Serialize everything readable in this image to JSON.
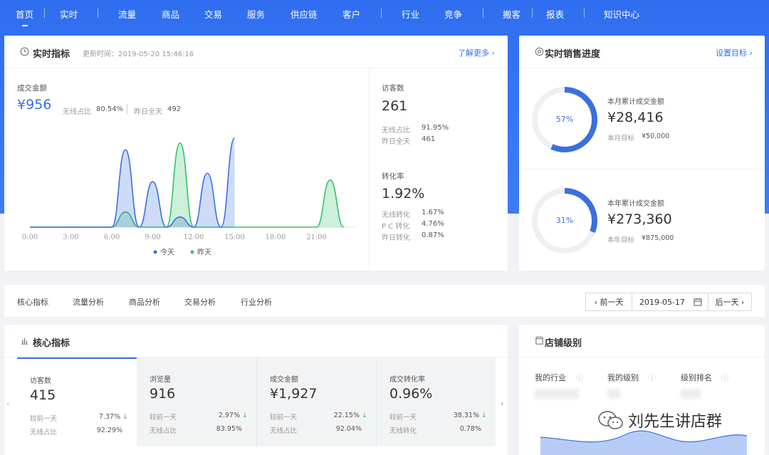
{
  "nav": {
    "items": [
      {
        "label": "首页",
        "active": true
      },
      {
        "label": "实时"
      },
      {
        "label": "流量"
      },
      {
        "label": "商品"
      },
      {
        "label": "交易"
      },
      {
        "label": "服务"
      },
      {
        "label": "供应链"
      },
      {
        "label": "客户"
      },
      {
        "label": "行业"
      },
      {
        "label": "竞争"
      },
      {
        "label": "搬客"
      },
      {
        "label": "报表"
      },
      {
        "label": "知识中心"
      }
    ]
  },
  "realtime": {
    "title": "实时指标",
    "updated_label": "更新时间：2019-05-20 15:46:16",
    "more_link": "了解更多 ›",
    "deal": {
      "label": "成交金额",
      "value": "¥956",
      "wireless_label": "无线占比",
      "wireless_value": "80.54%",
      "yesterday_label": "昨日全天",
      "yesterday_value": "492"
    },
    "visitors": {
      "label": "访客数",
      "value": "261",
      "rows": [
        {
          "label": "无线占比",
          "value": "91.95%"
        },
        {
          "label": "昨日全天",
          "value": "461"
        }
      ]
    },
    "conversion": {
      "label": "转化率",
      "value": "1.92%",
      "rows": [
        {
          "label": "无线转化",
          "value": "1.67%"
        },
        {
          "label": "P C 转化",
          "value": "4.76%"
        },
        {
          "label": "昨日转化",
          "value": "0.87%"
        }
      ]
    }
  },
  "chart_data": {
    "type": "area",
    "x_ticks": [
      "0:00",
      "3:00",
      "6:00",
      "9:00",
      "12:00",
      "15:00",
      "18:00",
      "21:00"
    ],
    "x_range": [
      0,
      24
    ],
    "hours": [
      0,
      1,
      2,
      3,
      4,
      5,
      6,
      7,
      8,
      9,
      10,
      11,
      12,
      13,
      14,
      15,
      16,
      17,
      18,
      19,
      20,
      21,
      22,
      23
    ],
    "series": [
      {
        "name": "今天",
        "color": "#3a6fe0",
        "values": [
          0,
          0,
          0,
          0,
          0,
          0,
          0,
          92,
          0,
          54,
          0,
          12,
          0,
          64,
          0,
          106,
          null,
          null,
          null,
          null,
          null,
          null,
          null,
          null
        ]
      },
      {
        "name": "昨天",
        "color": "#33c26b",
        "values": [
          0,
          0,
          0,
          0,
          0,
          0,
          0,
          18,
          0,
          0,
          0,
          100,
          0,
          0,
          0,
          0,
          0,
          0,
          0,
          0,
          0,
          0,
          56,
          0
        ]
      }
    ]
  },
  "sales": {
    "title": "实时销售进度",
    "set_link": "设置目标 ›",
    "month": {
      "percent": 57,
      "percent_label": "57%",
      "label": "本月累计成交金额",
      "value": "¥28,416",
      "target_label": "本月目标",
      "target_value": "¥50,000"
    },
    "year": {
      "percent": 31,
      "percent_label": "31%",
      "label": "本年累计成交金额",
      "value": "¥273,360",
      "target_label": "本年目标",
      "target_value": "¥875,000"
    }
  },
  "tabs": {
    "items": [
      "核心指标",
      "流量分析",
      "商品分析",
      "交易分析",
      "行业分析"
    ],
    "prev": "‹ 前一天",
    "date": "2019-05-17",
    "next": "后一天 ›"
  },
  "core": {
    "title": "核心指标",
    "metrics": [
      {
        "label": "访客数",
        "value": "415",
        "cmp_label": "较前一天",
        "cmp_value": "7.37%",
        "sub_label": "无线占比",
        "sub_value": "92.29%"
      },
      {
        "label": "浏览量",
        "value": "916",
        "cmp_label": "较前一天",
        "cmp_value": "2.97%",
        "sub_label": "无线占比",
        "sub_value": "83.95%"
      },
      {
        "label": "成交金额",
        "value": "¥1,927",
        "cmp_label": "较前一天",
        "cmp_value": "22.15%",
        "sub_label": "无线占比",
        "sub_value": "92.04%"
      },
      {
        "label": "成交转化率",
        "value": "0.96%",
        "cmp_label": "较前一天",
        "cmp_value": "38.31%",
        "sub_label": "无线转化",
        "sub_value": "0.78%"
      }
    ]
  },
  "store": {
    "title": "店铺级别",
    "cols": [
      "我的行业",
      "我的级别",
      "级别排名"
    ]
  },
  "watermark": "刘先生讲店群",
  "colors": {
    "primary": "#3a6fe0",
    "green": "#33c26b",
    "nav_bg": "#2f6ef0"
  }
}
